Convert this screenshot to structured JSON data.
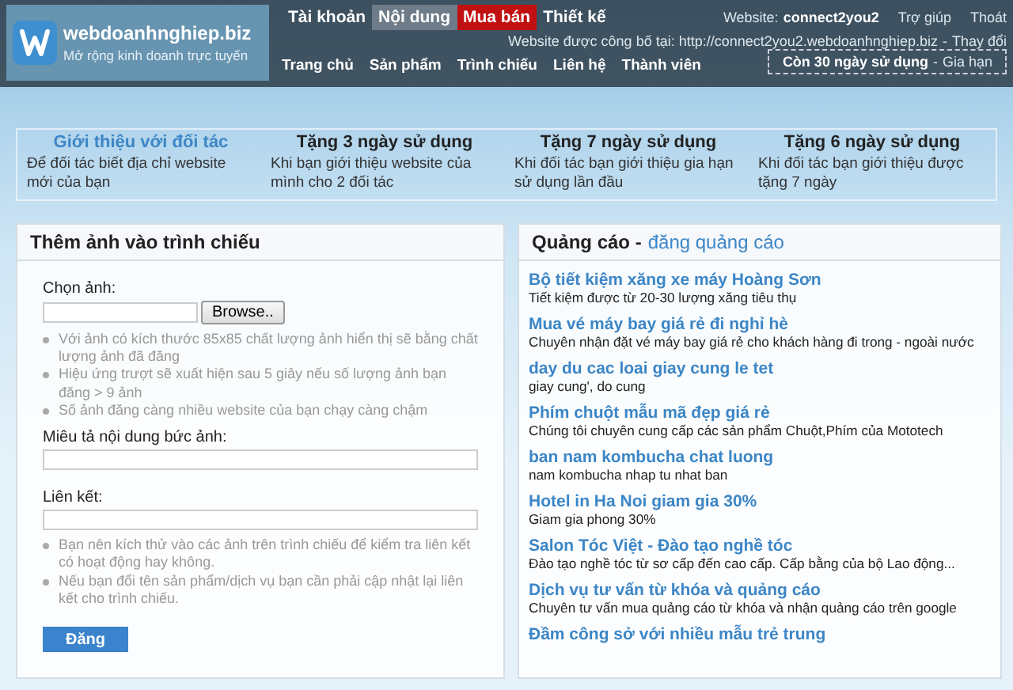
{
  "header": {
    "logo": {
      "title": "webdoanhnghiep.biz",
      "tagline": "Mở rộng kinh doanh trực tuyến"
    },
    "top_tabs": [
      {
        "label": "Tài khoản",
        "selected": false,
        "kind": "normal"
      },
      {
        "label": "Nội dung",
        "selected": true,
        "kind": "normal"
      },
      {
        "label": "Mua bán",
        "selected": false,
        "kind": "sale"
      },
      {
        "label": "Thiết kế",
        "selected": false,
        "kind": "normal"
      }
    ],
    "account": {
      "label": "Website:",
      "name": "connect2you2",
      "links": [
        "Trợ giúp",
        "Thoát"
      ]
    },
    "published": {
      "text": "Website được công bố tại: http://connect2you2.webdoanhnghiep.biz",
      "separator": "-",
      "link": "Thay đổi"
    },
    "nav": [
      "Trang chủ",
      "Sản phẩm",
      "Trình chiếu",
      "Liên hệ",
      "Thành viên"
    ],
    "trial": {
      "text": "Còn 30 ngày sử dụng",
      "separator": "-",
      "link": "Gia hạn"
    }
  },
  "promos": [
    {
      "title": "Giới thiệu với đối tác",
      "highlight": true,
      "text": "Để đối tác biết địa chỉ website mới của bạn"
    },
    {
      "title": "Tặng 3 ngày sử dụng",
      "highlight": false,
      "text": "Khi bạn giới thiệu website của mình cho 2 đối tác"
    },
    {
      "title": "Tặng 7 ngày sử dụng",
      "highlight": false,
      "text": "Khi đối tác bạn giới thiệu gia hạn sử dụng lần đầu"
    },
    {
      "title": "Tặng 6 ngày sử dụng",
      "highlight": false,
      "text": "Khi đối tác bạn giới thiệu được tặng 7 ngày"
    }
  ],
  "form": {
    "title": "Thêm ảnh vào trình chiếu",
    "image_label": "Chọn ảnh:",
    "browse": "Browse..",
    "image_notes": [
      "Với ảnh có kích thước 85x85 chất lượng ảnh hiển thị sẽ bằng chất lượng ảnh đã đăng",
      "Hiệu ứng trượt sẽ xuất hiện sau 5 giây nếu số lượng ảnh bạn đăng > 9 ảnh",
      "Số ảnh đăng càng nhiều website của bạn chạy càng chậm"
    ],
    "description_label": "Miêu tả nội dung bức ảnh:",
    "link_label": "Liên kết:",
    "link_notes": [
      "Bạn nên kích thử vào các ảnh trên trình chiếu để kiểm tra liên kết có hoạt động hay không.",
      "Nếu bạn đổi tên sản phẩm/dịch vụ bạn cần phải cập nhật lại liên kết cho trình chiếu."
    ],
    "submit": "Đăng"
  },
  "ads": {
    "title": "Quảng cáo -",
    "link": "đăng quảng cáo",
    "items": [
      {
        "title": "Bộ tiết kiệm xăng xe máy Hoàng Sơn",
        "text": "Tiết kiệm được từ 20-30 lượng xăng tiêu thụ"
      },
      {
        "title": "Mua vé máy bay giá rẻ đi nghỉ hè",
        "text": "Chuyên nhận đặt vé máy bay giá rẻ cho khách hàng đi trong - ngoài nước"
      },
      {
        "title": "day du cac loai giay cung le tet",
        "text": "giay cung', do cung"
      },
      {
        "title": "Phím chuột mẫu mã đẹp giá rẻ",
        "text": "Chúng tôi chuyên cung cấp các sản phẩm Chuột,Phím của Mototech"
      },
      {
        "title": "ban nam kombucha chat luong",
        "text": "nam kombucha nhap tu nhat ban"
      },
      {
        "title": "Hotel in Ha Noi giam gia 30%",
        "text": "Giam gia phong 30%"
      },
      {
        "title": "Salon Tóc Việt - Đào tạo nghề tóc",
        "text": "Đào tạo nghề tóc từ sơ cấp đến cao cấp. Cấp bằng của bộ Lao động..."
      },
      {
        "title": "Dịch vụ tư vấn từ khóa và quảng cáo",
        "text": "Chuyên tư vấn mua quảng cáo từ khóa và nhận quảng cáo trên google"
      },
      {
        "title": "Đầm công sở với nhiều mẫu trẻ trung"
      }
    ]
  }
}
